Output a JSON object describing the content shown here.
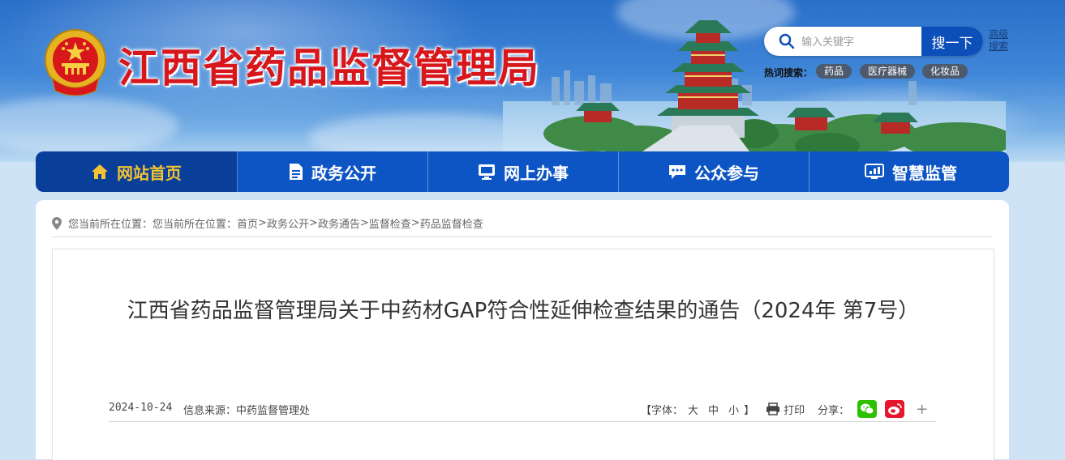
{
  "header": {
    "site_title": "江西省药品监督管理局",
    "search": {
      "placeholder": "输入关键字",
      "button_label": "搜一下",
      "advanced_label": "高级搜索"
    },
    "hot_search": {
      "label": "热词搜索：",
      "tags": [
        "药品",
        "医疗器械",
        "化妆品"
      ]
    }
  },
  "nav": {
    "items": [
      {
        "label": "网站首页",
        "icon": "home-icon",
        "active": true
      },
      {
        "label": "政务公开",
        "icon": "document-icon",
        "active": false
      },
      {
        "label": "网上办事",
        "icon": "monitor-icon",
        "active": false
      },
      {
        "label": "公众参与",
        "icon": "chat-icon",
        "active": false
      },
      {
        "label": "智慧监管",
        "icon": "dashboard-icon",
        "active": false
      }
    ]
  },
  "location": {
    "prefix": "您当前所在位置：您当前所在位置：",
    "crumbs": [
      "首页",
      "政务公开",
      "政务通告",
      "监督检查",
      "药品监督检查"
    ],
    "separator": ">"
  },
  "article": {
    "title": "江西省药品监督管理局关于中药材GAP符合性延伸检查结果的通告（2024年 第7号）",
    "date": "2024-10-24",
    "source": "信息来源：中药监督管理处",
    "font_size_label": "【字体：",
    "font_sizes": [
      "大",
      "中",
      "小"
    ],
    "font_size_close": "】",
    "print_label": "打印",
    "share_label": "分享：",
    "share_icons": [
      "wechat-icon",
      "weibo-icon"
    ],
    "more_label": "+"
  },
  "colors": {
    "title_red": "#d8171c",
    "nav_blue": "#0d55c4",
    "nav_active_bg": "#0a3f99",
    "nav_active_text": "#f2c232",
    "search_button": "#0d4fb8",
    "wechat": "#2dc100",
    "weibo": "#e6162d"
  }
}
